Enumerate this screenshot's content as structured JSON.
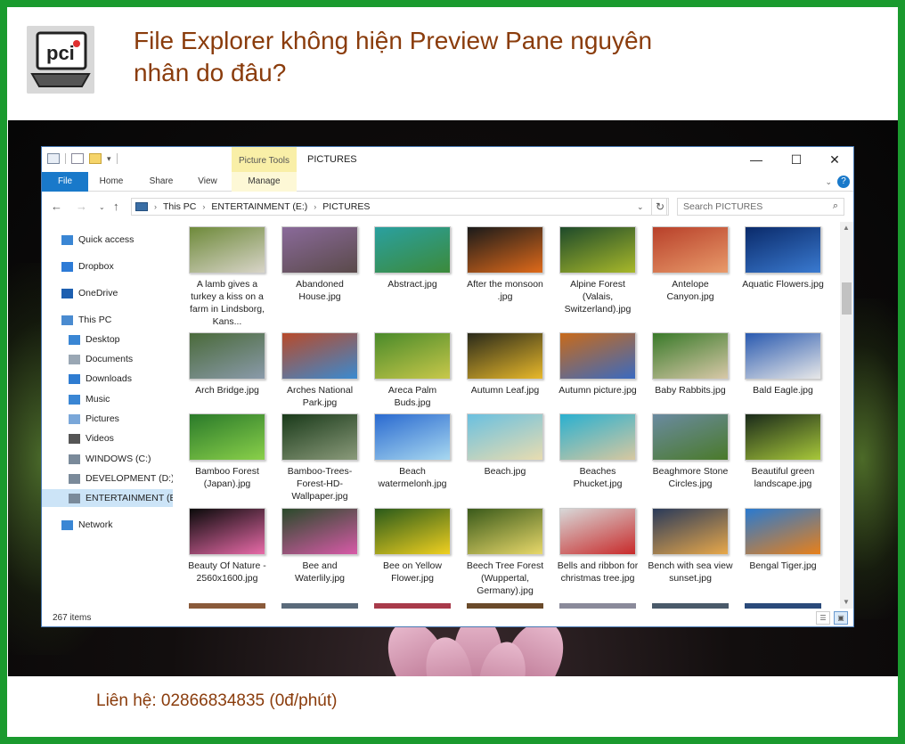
{
  "headline": "File Explorer không hiện Preview Pane nguyên nhân do đâu?",
  "contact": "Liên hệ: 02866834835 (0đ/phút)",
  "logo_text": "pci",
  "window": {
    "title": "PICTURES",
    "context_tab": "Picture Tools",
    "controls": {
      "minimize": "—",
      "maximize": "☐",
      "close": "✕"
    }
  },
  "ribbon": {
    "tabs": [
      "File",
      "Home",
      "Share",
      "View",
      "Manage"
    ]
  },
  "address": {
    "parts": [
      "This PC",
      "ENTERTAINMENT (E:)",
      "PICTURES"
    ],
    "search_placeholder": "Search PICTURES"
  },
  "nav": {
    "items": [
      {
        "label": "Quick access",
        "icon": "star-icon",
        "color": "#3a86d4"
      },
      {
        "label": "Dropbox",
        "icon": "dropbox-icon",
        "color": "#2d7bd6"
      },
      {
        "label": "OneDrive",
        "icon": "cloud-icon",
        "color": "#1d5fb0"
      },
      {
        "label": "This PC",
        "icon": "computer-icon",
        "color": "#4a8bd0"
      },
      {
        "label": "Desktop",
        "icon": "desktop-icon",
        "color": "#3a86d4"
      },
      {
        "label": "Documents",
        "icon": "documents-icon",
        "color": "#9aa7b4"
      },
      {
        "label": "Downloads",
        "icon": "download-icon",
        "color": "#2f7cd1"
      },
      {
        "label": "Music",
        "icon": "music-icon",
        "color": "#3a86d4"
      },
      {
        "label": "Pictures",
        "icon": "pictures-icon",
        "color": "#7aa7d9"
      },
      {
        "label": "Videos",
        "icon": "videos-icon",
        "color": "#555555"
      },
      {
        "label": "WINDOWS (C:)",
        "icon": "drive-c-icon",
        "color": "#7a8a9a"
      },
      {
        "label": "DEVELOPMENT (D:)",
        "icon": "drive-icon",
        "color": "#7a8a9a"
      },
      {
        "label": "ENTERTAINMENT (E:)",
        "icon": "drive-icon",
        "color": "#7a8a9a"
      },
      {
        "label": "Network",
        "icon": "network-icon",
        "color": "#3a86d4"
      }
    ]
  },
  "files": [
    {
      "name": "A lamb gives a turkey a kiss on a farm in Lindsborg, Kans...",
      "c1": "#6e8a3a",
      "c2": "#d8d4c8"
    },
    {
      "name": "Abandoned House.jpg",
      "c1": "#8a6a9a",
      "c2": "#5a4a4a"
    },
    {
      "name": "Abstract.jpg",
      "c1": "#2aa0a0",
      "c2": "#3c8a3a"
    },
    {
      "name": "After the monsoon .jpg",
      "c1": "#1a1a1a",
      "c2": "#e06a1a"
    },
    {
      "name": "Alpine Forest (Valais, Switzerland).jpg",
      "c1": "#1e4a2a",
      "c2": "#a8b82a"
    },
    {
      "name": "Antelope Canyon.jpg",
      "c1": "#b8402a",
      "c2": "#e89a6a"
    },
    {
      "name": "Aquatic Flowers.jpg",
      "c1": "#0a2a6a",
      "c2": "#3a7ad0"
    },
    {
      "name": "Arch Bridge.jpg",
      "c1": "#4a6a3a",
      "c2": "#8a9aaa"
    },
    {
      "name": "Arches National Park.jpg",
      "c1": "#b84a2a",
      "c2": "#3a8ad0"
    },
    {
      "name": "Areca Palm Buds.jpg",
      "c1": "#4a8a2a",
      "c2": "#c8c84a"
    },
    {
      "name": "Autumn Leaf.jpg",
      "c1": "#2a2a1a",
      "c2": "#e8b82a"
    },
    {
      "name": "Autumn picture.jpg",
      "c1": "#c86a1a",
      "c2": "#3a6ac0"
    },
    {
      "name": "Baby Rabbits.jpg",
      "c1": "#3a7a2a",
      "c2": "#d8c8a8"
    },
    {
      "name": "Bald Eagle.jpg",
      "c1": "#2a5ab0",
      "c2": "#e8e8e8"
    },
    {
      "name": "Bamboo Forest (Japan).jpg",
      "c1": "#2a7a2a",
      "c2": "#8ad04a"
    },
    {
      "name": "Bamboo-Trees-Forest-HD-Wallpaper.jpg",
      "c1": "#1a3a1a",
      "c2": "#8a9a7a"
    },
    {
      "name": "Beach watermelonh.jpg",
      "c1": "#2a6ad0",
      "c2": "#a8d8f0"
    },
    {
      "name": "Beach.jpg",
      "c1": "#6ac0e0",
      "c2": "#e8dcb0"
    },
    {
      "name": "Beaches Phucket.jpg",
      "c1": "#2ab0d0",
      "c2": "#d8c8a0"
    },
    {
      "name": "Beaghmore Stone Circles.jpg",
      "c1": "#6a8aa0",
      "c2": "#4a7a2a"
    },
    {
      "name": "Beautiful green landscape.jpg",
      "c1": "#1a2a1a",
      "c2": "#a8c83a"
    },
    {
      "name": "Beauty Of Nature - 2560x1600.jpg",
      "c1": "#0a0a0a",
      "c2": "#e86aa8"
    },
    {
      "name": "Bee and Waterlily.jpg",
      "c1": "#2a4a2a",
      "c2": "#d85aa8"
    },
    {
      "name": "Bee on Yellow Flower.jpg",
      "c1": "#2a5a1a",
      "c2": "#f0d020"
    },
    {
      "name": "Beech Tree Forest (Wuppertal, Germany).jpg",
      "c1": "#3a5a1a",
      "c2": "#e8d86a"
    },
    {
      "name": "Bells and ribbon for christmas tree.jpg",
      "c1": "#d8d8d8",
      "c2": "#c82a2a"
    },
    {
      "name": "Bench with sea view sunset.jpg",
      "c1": "#2a3a5a",
      "c2": "#e8a84a"
    },
    {
      "name": "Bengal Tiger.jpg",
      "c1": "#2a7ad0",
      "c2": "#e8801a"
    }
  ],
  "status": {
    "items": "267 items"
  }
}
